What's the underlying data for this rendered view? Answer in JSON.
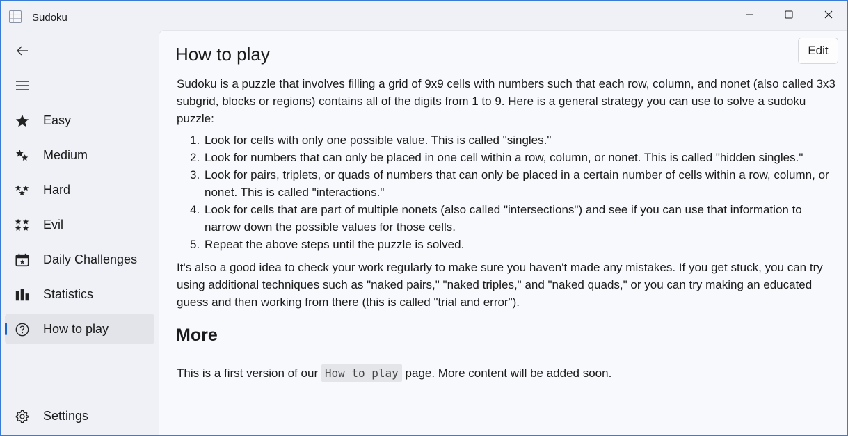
{
  "window": {
    "title": "Sudoku"
  },
  "sidebar": {
    "items": [
      {
        "label": "Easy",
        "icon": "star-filled-icon"
      },
      {
        "label": "Medium",
        "icon": "star-partial-icon"
      },
      {
        "label": "Hard",
        "icon": "three-stars-icon"
      },
      {
        "label": "Evil",
        "icon": "four-stars-icon"
      },
      {
        "label": "Daily Challenges",
        "icon": "calendar-star-icon"
      },
      {
        "label": "Statistics",
        "icon": "bar-chart-icon"
      },
      {
        "label": "How to play",
        "icon": "question-circle-icon",
        "selected": true
      }
    ],
    "settings_label": "Settings"
  },
  "page": {
    "title": "How to play",
    "edit_label": "Edit",
    "intro": "Sudoku is a puzzle that involves filling a grid of 9x9 cells with numbers such that each row, column, and nonet (also called 3x3 subgrid, blocks or regions) contains all of the digits from 1 to 9. Here is a general strategy you can use to solve a sudoku puzzle:",
    "steps": [
      {
        "num": "1.",
        "text": "Look for cells with only one possible value. This is called \"singles.\""
      },
      {
        "num": "2.",
        "text": "Look for numbers that can only be placed in one cell within a row, column, or nonet. This is called \"hidden singles.\""
      },
      {
        "num": "3.",
        "text": "Look for pairs, triplets, or quads of numbers that can only be placed in a certain number of cells within a row, column, or nonet. This is called \"interactions.\""
      },
      {
        "num": "4.",
        "text": "Look for cells that are part of multiple nonets (also called \"intersections\") and see if you can use that information to narrow down the possible values for those cells."
      },
      {
        "num": "5.",
        "text": "Repeat the above steps until the puzzle is solved."
      }
    ],
    "outro": "It's also a good idea to check your work regularly to make sure you haven't made any mistakes. If you get stuck, you can try using additional techniques such as \"naked pairs,\" \"naked triples,\" and \"naked quads,\" or you can try making an educated guess and then working from there (this is called \"trial and error\").",
    "more_heading": "More",
    "more_prefix": "This is a first version of our ",
    "more_code": "How to play",
    "more_suffix": " page. More content will be added soon."
  },
  "colors": {
    "accent": "#1d64c8",
    "selected_bg": "#e2e4ea"
  }
}
